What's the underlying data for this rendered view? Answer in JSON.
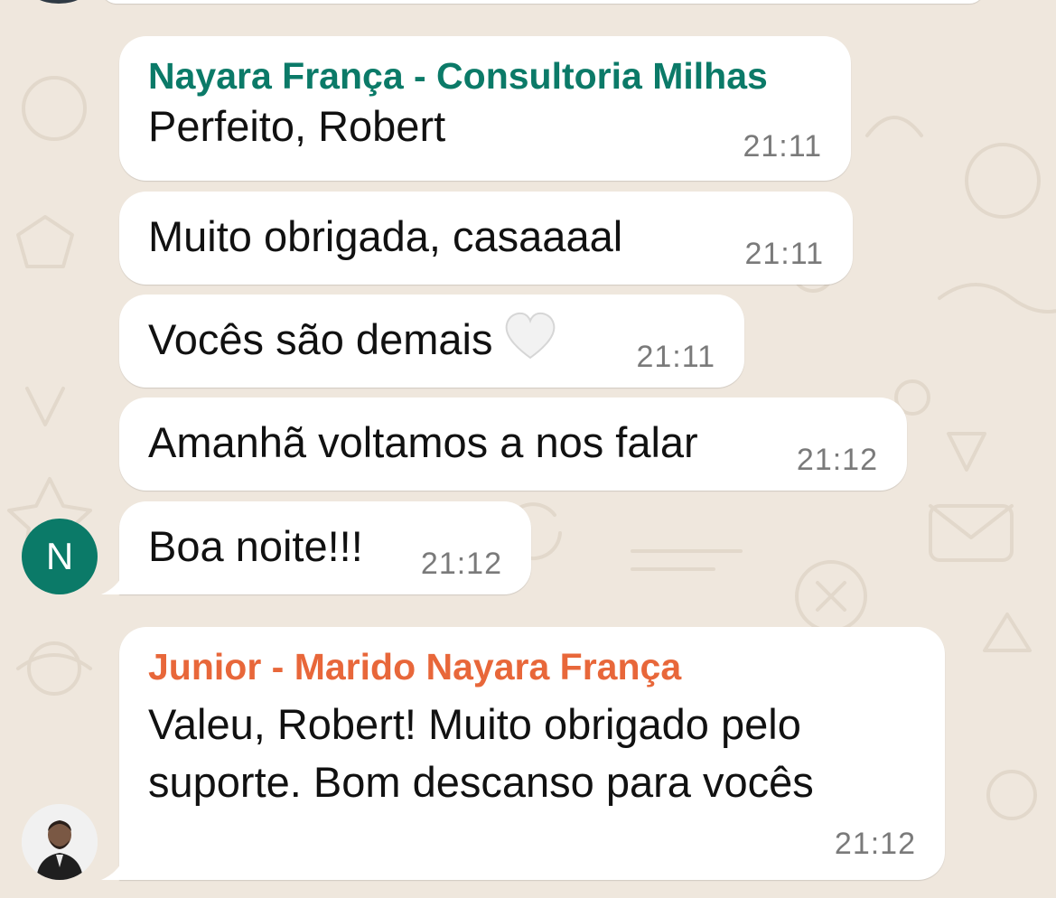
{
  "chat": {
    "avatar_n_letter": "N",
    "messages": [
      {
        "sender": "Nayara França - Consultoria Milhas",
        "sender_color": "#0b7a68",
        "text": "Perfeito, Robert",
        "time": "21:11"
      },
      {
        "text": "Muito obrigada, casaaaal",
        "time": "21:11"
      },
      {
        "text": "Vocês são demais",
        "emoji": "white-heart",
        "time": "21:11"
      },
      {
        "text": "Amanhã voltamos a nos falar",
        "time": "21:12"
      },
      {
        "text": "Boa noite!!!",
        "time": "21:12"
      },
      {
        "sender": "Junior - Marido Nayara França",
        "sender_color": "#e8673a",
        "text_lines": [
          "Valeu, Robert! Muito obrigado pelo",
          "suporte. Bom descanso para vocês"
        ],
        "time": "21:12"
      }
    ]
  },
  "colors": {
    "background": "#efe7dd",
    "bubble": "#ffffff",
    "timestamp": "#7a7a7a",
    "avatar_n": "#0b7a68"
  }
}
